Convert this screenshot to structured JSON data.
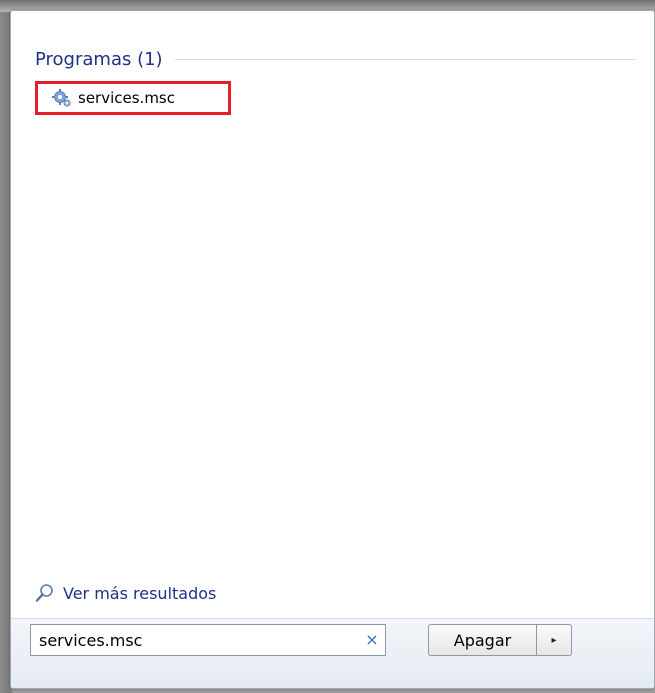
{
  "results": {
    "group_title": "Programas (1)",
    "items": [
      {
        "label": "services.msc",
        "icon": "services-gear-icon"
      }
    ],
    "more_results_label": "Ver más resultados",
    "more_results_icon": "magnifier-icon"
  },
  "search": {
    "value": "services.msc",
    "clear_glyph": "×"
  },
  "power": {
    "shutdown_label": "Apagar",
    "arrow_glyph": "▸"
  },
  "colors": {
    "link_blue": "#1e3287",
    "highlight_red": "#e21e2a"
  }
}
